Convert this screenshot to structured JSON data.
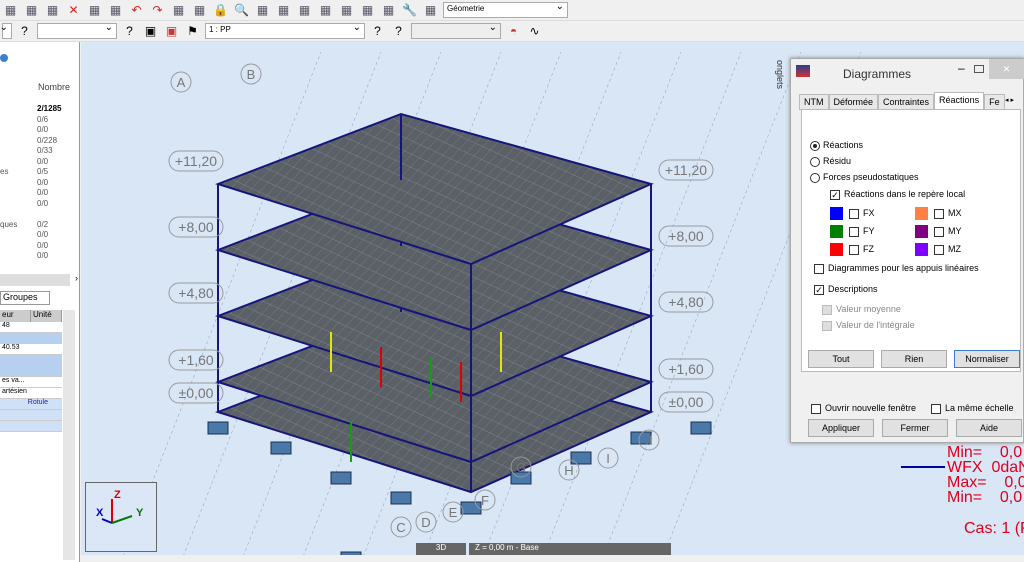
{
  "toolbar1": {
    "icons": [
      "open-icon",
      "preview-icon",
      "screenshot-icon",
      "delete-icon",
      "copy-icon",
      "paste-icon",
      "undo-icon",
      "redo-icon",
      "table-icon",
      "table2-icon",
      "lock-icon",
      "zoom-icon",
      "zoom-window-icon",
      "grid-icon",
      "axis-icon",
      "measure-icon",
      "section-icon",
      "building-icon",
      "load-icon",
      "wrench-icon",
      "layout-icon"
    ],
    "layout_select": "Géometrie"
  },
  "toolbar2": {
    "case_select": "1 : PP"
  },
  "left_panel": {
    "col_header": "Nombre",
    "counts": [
      "2/1285",
      "0/6",
      "0/0",
      "0/228",
      "0/33",
      "0/0",
      "0/5",
      "0/0",
      "0/0",
      "0/0",
      "",
      "0/2",
      "0/0",
      "0/0",
      "0/0"
    ],
    "label_fragments": {
      "6": "es",
      "11": "ques"
    },
    "tab": "Groupes",
    "prop_headers": [
      "eur",
      "Unité"
    ],
    "prop_rows": [
      "48",
      "",
      "40.53",
      "",
      "",
      "es va...",
      "artésien",
      "Rotule",
      "",
      ""
    ]
  },
  "viewport": {
    "level_labels_left": [
      "+11,20",
      "+8,00",
      "+4,80",
      "+1,60",
      "±0,00"
    ],
    "level_labels_right": [
      "+11,20",
      "+8,00",
      "+4,80",
      "+1,60",
      "±0,00"
    ],
    "axis_letters": [
      "A",
      "B",
      "C",
      "D",
      "E",
      "F",
      "G",
      "H",
      "I",
      "J"
    ],
    "view_mode": "3D",
    "plane": "Z = 0,00 m - Base",
    "onglets": "onglets",
    "triad": {
      "x": "X",
      "y": "Y",
      "z": "Z"
    }
  },
  "dialog": {
    "title": "Diagrammes",
    "tabs": [
      "NTM",
      "Déformée",
      "Contraintes",
      "Réactions",
      "Fe"
    ],
    "active_tab": "Réactions",
    "radios": [
      {
        "label": "Réactions",
        "checked": true
      },
      {
        "label": "Résidu",
        "checked": false
      },
      {
        "label": "Forces pseudostatiques",
        "checked": false
      }
    ],
    "local_frame": {
      "label": "Réactions dans le repère local",
      "checked": true
    },
    "components": [
      {
        "label": "FX",
        "color": "#0000ff"
      },
      {
        "label": "MX",
        "color": "#ff8040"
      },
      {
        "label": "FY",
        "color": "#008000"
      },
      {
        "label": "MY",
        "color": "#800080"
      },
      {
        "label": "FZ",
        "color": "#ff0000"
      },
      {
        "label": "MZ",
        "color": "#8000ff"
      }
    ],
    "linear_supports": "Diagrammes pour les appuis linéaires",
    "descriptions": "Descriptions",
    "mean_value": "Valeur moyenne",
    "integral_value": "Valeur de l'intégrale",
    "buttons": [
      "Tout",
      "Rien",
      "Normaliser"
    ],
    "new_window": "Ouvrir nouvelle fenêtre",
    "same_scale": "La même échelle",
    "actions": [
      "Appliquer",
      "Fermer",
      "Aide"
    ]
  },
  "legend": {
    "lines": [
      "Min=    0,0",
      "WFX  0daN",
      "Max=    0,0",
      "Min=    0,0"
    ],
    "case": "Cas: 1 (P"
  }
}
